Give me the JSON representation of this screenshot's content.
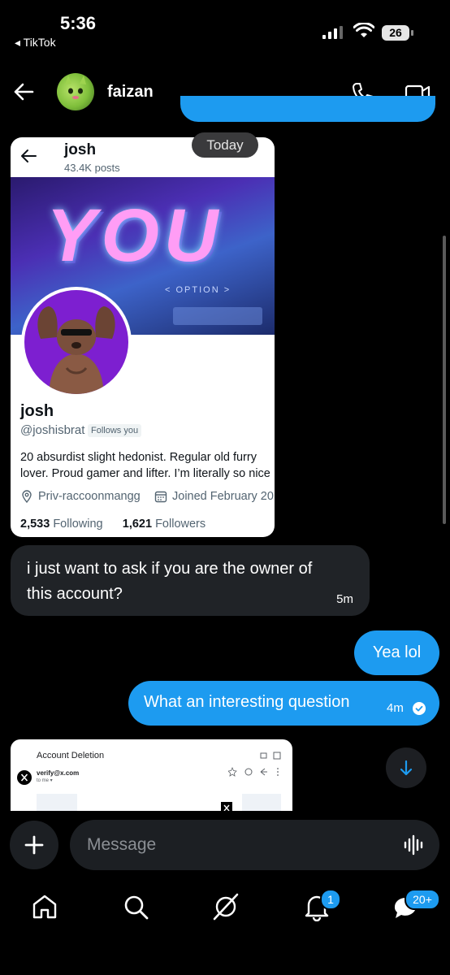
{
  "status_bar": {
    "time": "5:36",
    "back_app": "◂ TikTok",
    "battery": "26"
  },
  "header": {
    "contact_name": "faizan",
    "icons": [
      "back-arrow-icon",
      "phone-icon",
      "video-icon"
    ]
  },
  "shared_image": {
    "profile_name": "josh",
    "posts": "43.4K posts",
    "banner_text": "YOU",
    "banner_sub": "< OPTION >",
    "display_name": "josh",
    "handle": "@joshisbrat",
    "follows_badge": "Follows you",
    "bio_line1": "20 absurdist slight hedonist. Regular old furry",
    "bio_line2": "lover. Proud gamer and lifter. I’m literally so nice",
    "location": "Priv-raccoonmangg",
    "joined": "Joined February 20",
    "following_count": "2,533",
    "following_label": "Following",
    "followers_count": "1,621",
    "followers_label": "Followers"
  },
  "today_label": "Today",
  "messages": {
    "incoming": {
      "text": "i just want to ask if you are the owner of this account?",
      "time": "5m"
    },
    "outgoing1": {
      "text": "Yea lol"
    },
    "outgoing2": {
      "text": "What an interesting question",
      "time": "4m"
    }
  },
  "email_preview": {
    "title": "Account Deletion",
    "from": "verify@x.com",
    "to": "to me ▾"
  },
  "composer": {
    "placeholder": "Message"
  },
  "bottom_nav": {
    "notifications_badge": "1",
    "messages_badge": "20+"
  },
  "colors": {
    "accent": "#1d9bf0",
    "incoming_bubble": "#202327",
    "background": "#000000"
  }
}
